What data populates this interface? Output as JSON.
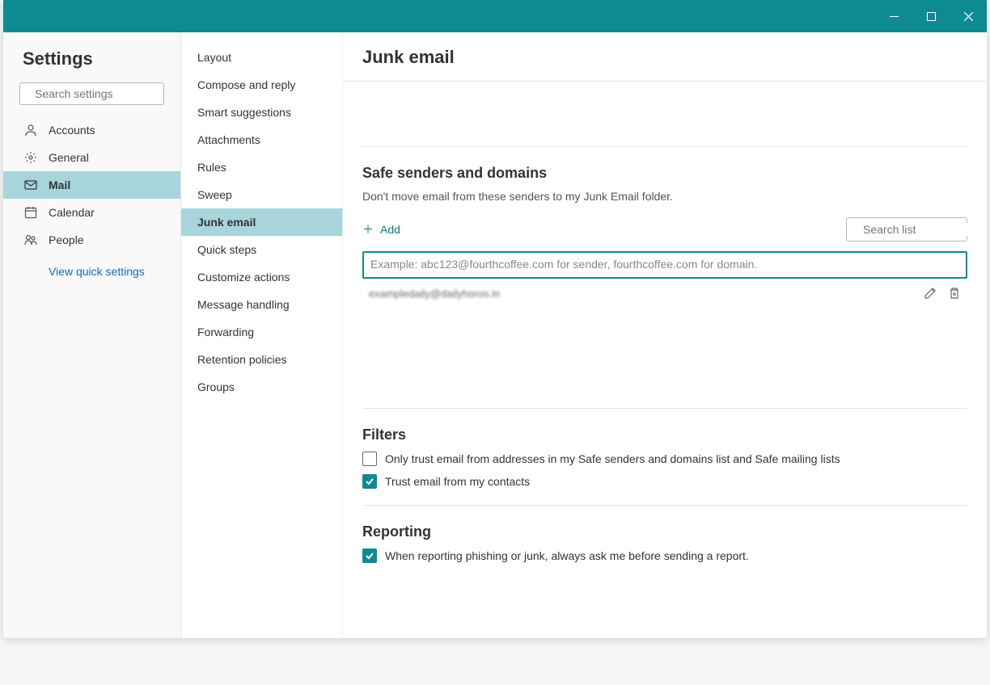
{
  "titlebar": {
    "minimize": "–",
    "maximize": "□",
    "close": "✕"
  },
  "col1": {
    "title": "Settings",
    "search_placeholder": "Search settings",
    "items": [
      {
        "label": "Accounts",
        "icon": "person"
      },
      {
        "label": "General",
        "icon": "gear"
      },
      {
        "label": "Mail",
        "icon": "mail",
        "active": true
      },
      {
        "label": "Calendar",
        "icon": "calendar"
      },
      {
        "label": "People",
        "icon": "people"
      }
    ],
    "quick_settings": "View quick settings"
  },
  "col2": {
    "items": [
      {
        "label": "Layout"
      },
      {
        "label": "Compose and reply"
      },
      {
        "label": "Smart suggestions"
      },
      {
        "label": "Attachments"
      },
      {
        "label": "Rules"
      },
      {
        "label": "Sweep"
      },
      {
        "label": "Junk email",
        "active": true
      },
      {
        "label": "Quick steps"
      },
      {
        "label": "Customize actions"
      },
      {
        "label": "Message handling"
      },
      {
        "label": "Forwarding"
      },
      {
        "label": "Retention policies"
      },
      {
        "label": "Groups"
      }
    ]
  },
  "page": {
    "title": "Junk email",
    "safe_senders": {
      "title": "Safe senders and domains",
      "desc": "Don't move email from these senders to my Junk Email folder.",
      "add": "Add",
      "search_placeholder": "Search list",
      "input_placeholder": "Example: abc123@fourthcoffee.com for sender, fourthcoffee.com for domain.",
      "entry": "exampledaily@dailyhoros.in"
    },
    "filters": {
      "title": "Filters",
      "only_trust": "Only trust email from addresses in my Safe senders and domains list and Safe mailing lists",
      "trust_contacts": "Trust email from my contacts"
    },
    "reporting": {
      "title": "Reporting",
      "ask_before": "When reporting phishing or junk, always ask me before sending a report."
    }
  }
}
